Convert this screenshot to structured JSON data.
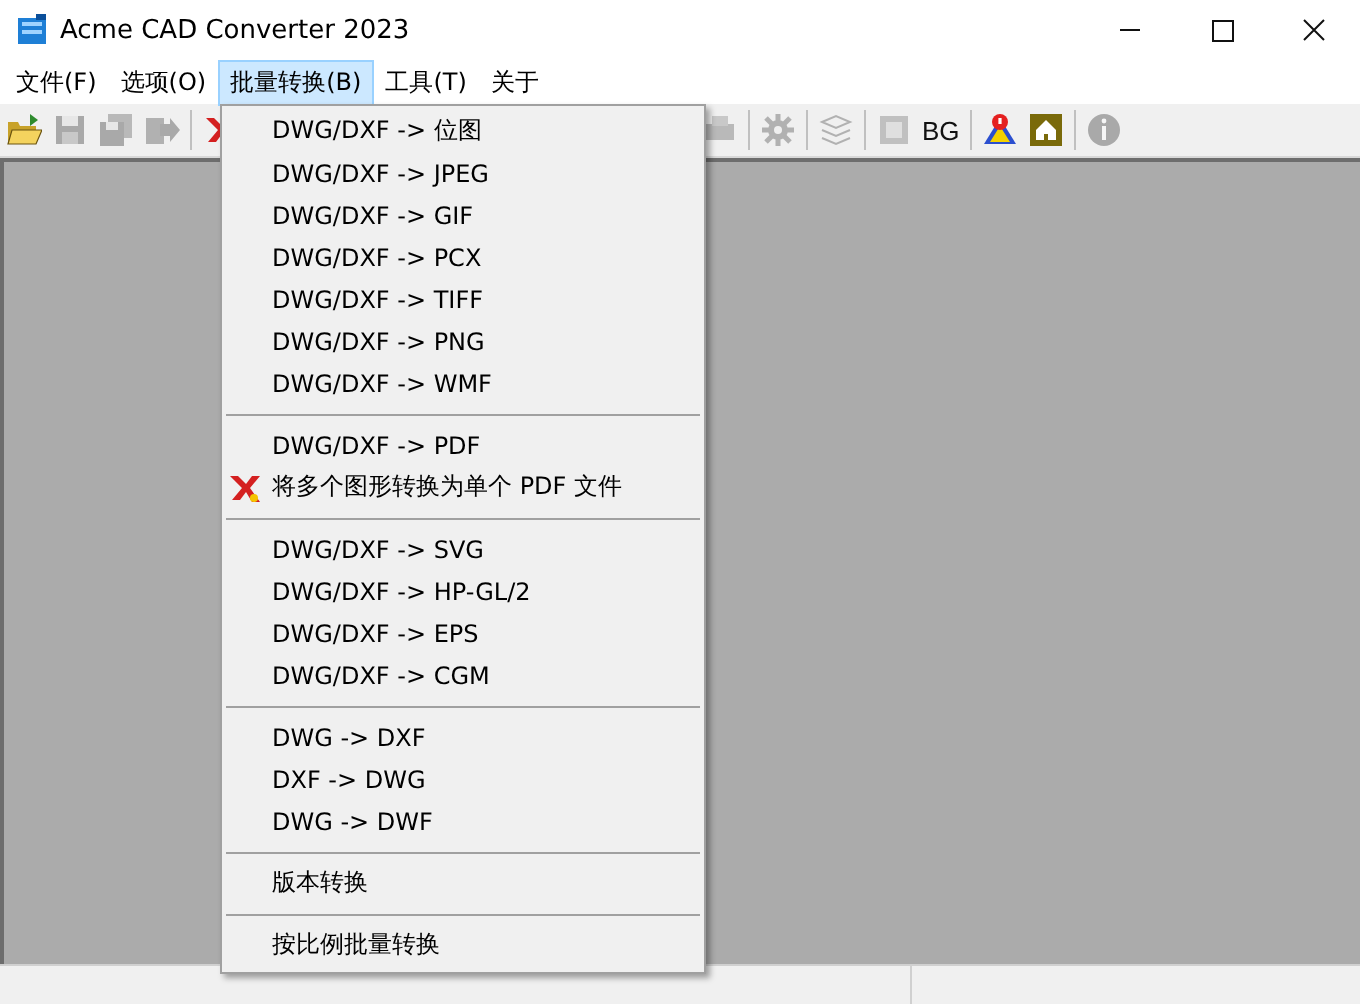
{
  "window": {
    "title": "Acme CAD Converter 2023"
  },
  "menu_bar": [
    {
      "label": "文件(F)",
      "selected": false
    },
    {
      "label": "选项(O)",
      "selected": false
    },
    {
      "label": "批量转换(B)",
      "selected": true
    },
    {
      "label": "工具(T)",
      "selected": false
    },
    {
      "label": "关于",
      "selected": false
    }
  ],
  "toolbar": [
    {
      "kind": "open",
      "disabled": false
    },
    {
      "kind": "save",
      "disabled": true
    },
    {
      "kind": "saveall",
      "disabled": true
    },
    {
      "kind": "export",
      "disabled": true
    },
    {
      "kind": "separator"
    },
    {
      "kind": "pdf",
      "disabled": false
    },
    {
      "kind": "gap"
    },
    {
      "kind": "print",
      "disabled": true
    },
    {
      "kind": "separator"
    },
    {
      "kind": "gear",
      "disabled": true
    },
    {
      "kind": "separator"
    },
    {
      "kind": "layers",
      "disabled": true
    },
    {
      "kind": "separator"
    },
    {
      "kind": "frame",
      "disabled": true
    },
    {
      "kind": "text",
      "label": "BG",
      "disabled": false
    },
    {
      "kind": "separator"
    },
    {
      "kind": "help",
      "disabled": false
    },
    {
      "kind": "home",
      "disabled": false
    },
    {
      "kind": "separator"
    },
    {
      "kind": "info",
      "disabled": true
    }
  ],
  "dropdown": [
    {
      "kind": "item",
      "label": "DWG/DXF -> 位图"
    },
    {
      "kind": "item",
      "label": "DWG/DXF -> JPEG"
    },
    {
      "kind": "item",
      "label": "DWG/DXF -> GIF"
    },
    {
      "kind": "item",
      "label": "DWG/DXF -> PCX"
    },
    {
      "kind": "item",
      "label": "DWG/DXF -> TIFF"
    },
    {
      "kind": "item",
      "label": "DWG/DXF -> PNG"
    },
    {
      "kind": "item",
      "label": "DWG/DXF -> WMF"
    },
    {
      "kind": "separator"
    },
    {
      "kind": "item",
      "label": "DWG/DXF -> PDF"
    },
    {
      "kind": "icon-item",
      "label": "将多个图形转换为单个 PDF 文件"
    },
    {
      "kind": "separator"
    },
    {
      "kind": "item",
      "label": "DWG/DXF -> SVG"
    },
    {
      "kind": "item",
      "label": "DWG/DXF -> HP-GL/2"
    },
    {
      "kind": "item",
      "label": "DWG/DXF -> EPS"
    },
    {
      "kind": "item",
      "label": "DWG/DXF -> CGM"
    },
    {
      "kind": "separator"
    },
    {
      "kind": "item",
      "label": "DWG -> DXF"
    },
    {
      "kind": "item",
      "label": "DXF -> DWG"
    },
    {
      "kind": "item",
      "label": "DWG -> DWF"
    },
    {
      "kind": "separator"
    },
    {
      "kind": "item",
      "label": "版本转换"
    },
    {
      "kind": "separator"
    },
    {
      "kind": "item",
      "label": "按比例批量转换"
    }
  ]
}
